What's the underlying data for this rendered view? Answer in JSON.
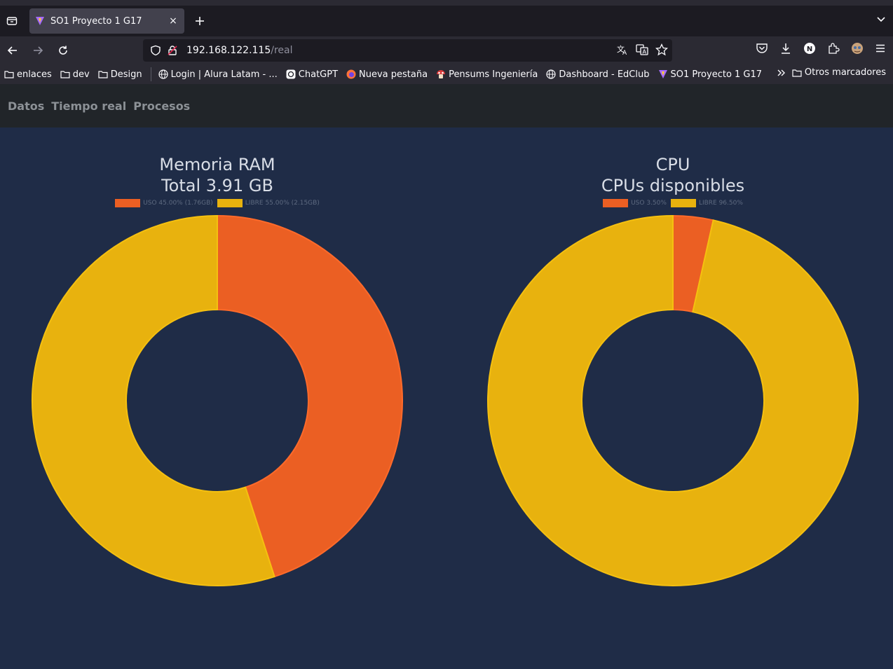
{
  "browser": {
    "tab": {
      "title": "SO1 Proyecto 1 G17",
      "close_label": "×"
    },
    "newtab_label": "+",
    "url": {
      "host": "192.168.122.115",
      "path": "/real"
    },
    "bookmarks": [
      {
        "label": "enlaces",
        "icon": "folder-icon"
      },
      {
        "label": "dev",
        "icon": "folder-icon"
      },
      {
        "label": "Design",
        "icon": "folder-icon"
      },
      {
        "label": "Login | Alura Latam - ...",
        "icon": "globe-icon"
      },
      {
        "label": "ChatGPT",
        "icon": "chatgpt-icon"
      },
      {
        "label": "Nueva pestaña",
        "icon": "firefox-icon"
      },
      {
        "label": "Pensums Ingeniería",
        "icon": "mushroom-icon"
      },
      {
        "label": "Dashboard - EdClub",
        "icon": "globe-icon"
      },
      {
        "label": "SO1 Proyecto 1 G17",
        "icon": "vite-icon"
      }
    ],
    "other_bookmarks": "Otros marcadores",
    "profile_letter": "N"
  },
  "appnav": {
    "links": [
      "Datos",
      "Tiempo real",
      "Procesos"
    ]
  },
  "ram": {
    "title_line1": "Memoria RAM",
    "title_line2": "Total 3.91 GB",
    "legend_uso": "USO 45.00% (1.76GB)",
    "legend_libre": "LIBRE 55.00% (2.15GB)"
  },
  "cpu": {
    "title_line1": "CPU",
    "title_line2": "CPUs disponibles",
    "legend_uso": "USO 3.50%",
    "legend_libre": "LIBRE 96.50%"
  },
  "colors": {
    "uso": "#eb5f23",
    "libre": "#e8b20e",
    "background": "#1f2c47"
  },
  "chart_data": [
    {
      "type": "pie",
      "title": "Memoria RAM / Total 3.91 GB",
      "categories": [
        "USO 45.00% (1.76GB)",
        "LIBRE 55.00% (2.15GB)"
      ],
      "values": [
        45.0,
        55.0
      ],
      "legend": "top"
    },
    {
      "type": "pie",
      "title": "CPU / CPUs disponibles",
      "categories": [
        "USO 3.50%",
        "LIBRE 96.50%"
      ],
      "values": [
        3.5,
        96.5
      ],
      "legend": "top"
    }
  ]
}
